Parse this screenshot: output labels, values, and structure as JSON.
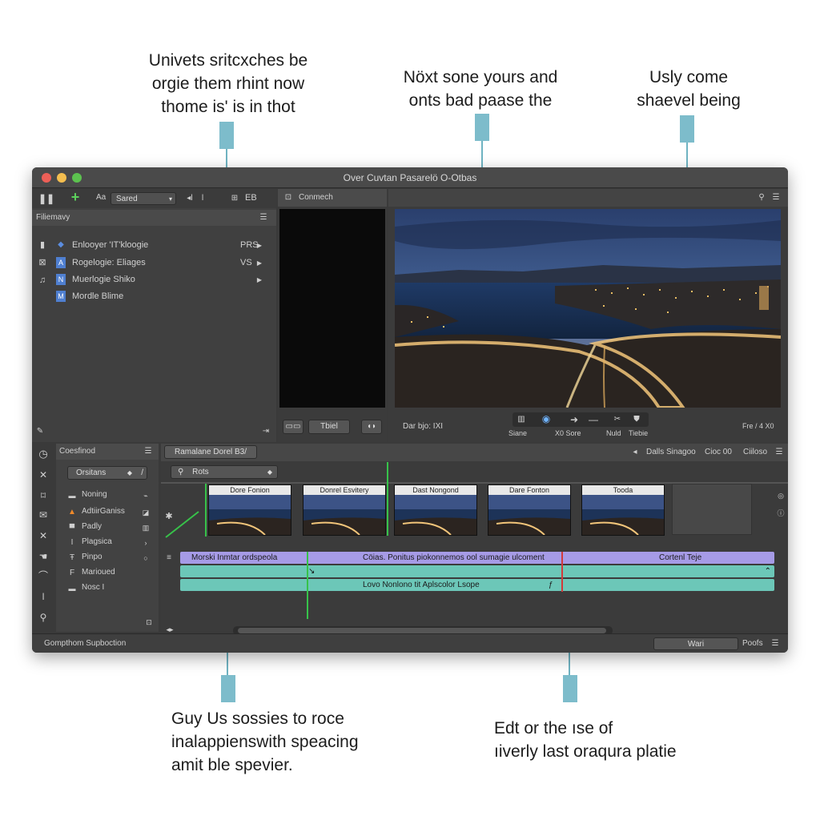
{
  "callouts": {
    "top_left": [
      "Univets sritcxches be",
      "orgie them rhint now",
      "thome is' is in thot"
    ],
    "top_center": [
      "Nöxt sone yours and",
      "onts bad paase the"
    ],
    "top_right": [
      "Usly come",
      "shaevel being"
    ],
    "bottom_left": [
      "Guy Us sossies to roce",
      "inalappienswith speacing",
      "amit ble spevier."
    ],
    "bottom_right": [
      "Edt or the ıse of",
      "ıiverly last oraqura platie"
    ]
  },
  "window": {
    "title": "Over Cuvtan Pasarelö O-Otbas"
  },
  "toolbar": {
    "field_prefix": "Aa",
    "field_value": "Sared",
    "right_label": "EB"
  },
  "library": {
    "header": "Filiemavy",
    "items": [
      {
        "label": "Enlooyer 'IT'kloogie",
        "shortcut": "PRS"
      },
      {
        "label": "Rogelogie: Eliages",
        "shortcut": "VS"
      },
      {
        "label": "Muerlogie Shiko",
        "shortcut": ""
      },
      {
        "label": "Mordle Blime",
        "shortcut": ""
      }
    ]
  },
  "source": {
    "tab_label": "Conmech",
    "btn1": "",
    "btn2": "Tbiel",
    "btn3": ""
  },
  "viewer": {
    "timecode": "Dar bjo: IXI",
    "right_readout": "Fre / 4 X0",
    "labels": [
      "Siane",
      "X0 Sore",
      "Nuld",
      "Tiebie"
    ]
  },
  "effects": {
    "header": "Coesfinod",
    "dropdown": "Orsitans",
    "items": [
      "Noning",
      "AdtiirGaniss",
      "Padly",
      "Plagsica",
      "Pinpo",
      "Marioued",
      "Nosc I"
    ],
    "status": "Gompthom Supboction"
  },
  "timeline": {
    "tab_label": "Ramalane Dorel B3/",
    "search_value": "Rots",
    "header_buttons": [
      "Dalls Sinagoo",
      "Cioc 00",
      "Ciiloso"
    ],
    "clips": [
      "Dore Fonion",
      "Donrel Esvitery",
      "Dast Nongond",
      "Dare Fonton",
      "Tooda"
    ],
    "tracks": {
      "track1_left": "Morski Inmtar ordspeola",
      "track1_mid": "Cöias. Ponitus piokonnemos ool sumagie ulcoment",
      "track1_right": "Cortenl Teje",
      "track3": "Lovo Nonlono tit Aplscolor Lsope"
    },
    "footer_btn1": "Wari",
    "footer_btn2": "Poofs"
  },
  "colors": {
    "callout_accent": "#7dbccb",
    "track_purple": "#a69be6",
    "track_teal": "#6cc7b8",
    "playhead_green": "#37c24a",
    "marker_red": "#d23a3a"
  }
}
